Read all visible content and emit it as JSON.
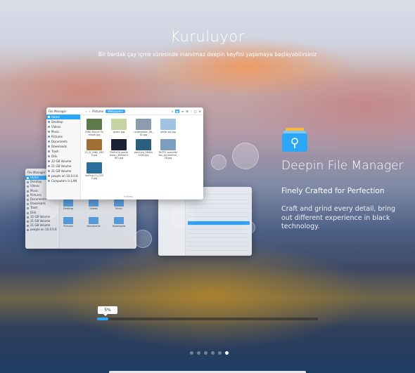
{
  "installer": {
    "title": "Kuruluyor",
    "subtitle": "Bir bardak çay içme süresinde inanılmaz deepin keyfini yaşamaya başlayabilirsiniz"
  },
  "slide": {
    "app_name": "Deepin File Manager",
    "tagline": "Finely Crafted for Perfection",
    "description": "Craft and grind every detail, bring out different experience in black technology."
  },
  "file_manager": {
    "window_title": "File Manager",
    "breadcrumb": [
      "Pictures",
      "Wallpapers"
    ],
    "sidebar": [
      "Home",
      "Desktop",
      "Videos",
      "Music",
      "Pictures",
      "Documents",
      "Downloads",
      "Trash",
      "Disk",
      "32 GB Volume",
      "21 GB Volume",
      "21 GB Volume",
      "people on 10.0.0.6",
      "Computers in LAN"
    ],
    "active_sidebar_index": 0,
    "files": [
      {
        "name": "2560 Mount Overlook.jpg",
        "color": "#5d7b4a"
      },
      {
        "name": "green.jpg",
        "color": "#c7d3a1"
      },
      {
        "name": "underwater_66_ID.jpg",
        "color": "#8a9cae"
      },
      {
        "name": "white sky.jpg",
        "color": "#9fc3e0"
      },
      {
        "name": "23_ft_0960_0600.jpg",
        "color": "#a06f35"
      },
      {
        "name": "2560x16 (earthmoon_3840x2160).jpg",
        "color": "#1b2233"
      },
      {
        "name": "parched_3840x2160.jpg",
        "color": "#2b5f7e"
      },
      {
        "name": "DIGTS_spaceforwin_byceseline_28.jpg",
        "color": "#7d9fbf"
      },
      {
        "name": "surfing (2)_0239.jpg",
        "color": "#2a6e9b"
      }
    ],
    "status": "9 items"
  },
  "back_window": {
    "title": "File Manager",
    "sidebar": [
      "Home",
      "Desktop",
      "Videos",
      "Music",
      "Pictures",
      "Documents",
      "Downloads",
      "Trash",
      "Disk",
      "32 GB Volume",
      "21 GB Volume",
      "21 GB Volume",
      "people on 10.0.0.6"
    ],
    "folders": [
      "Desktop",
      "Videos",
      "Music",
      "Pictures",
      "Documents",
      "Downloads"
    ]
  },
  "progress": {
    "label": "5%",
    "value": 0.05
  },
  "pager": {
    "count": 6,
    "active": 5
  },
  "colors": {
    "accent": "#2ca7f8"
  }
}
